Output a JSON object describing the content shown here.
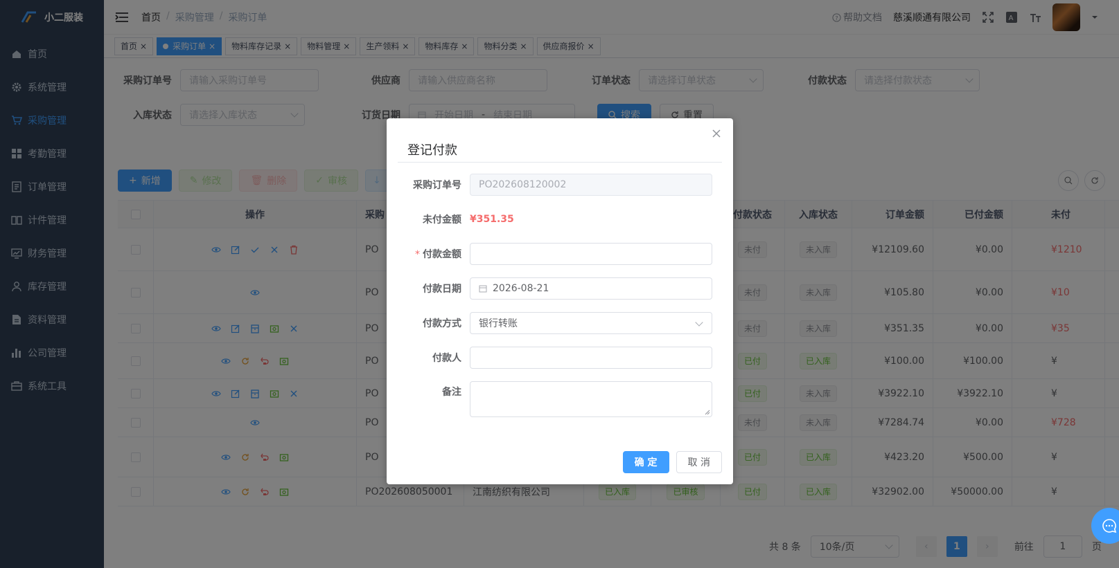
{
  "app": {
    "name": "小二服装"
  },
  "sidebar": {
    "items": [
      {
        "label": "首页",
        "icon": "home-icon"
      },
      {
        "label": "系统管理",
        "icon": "gear-icon"
      },
      {
        "label": "采购管理",
        "icon": "cart-icon",
        "active": true
      },
      {
        "label": "考勤管理",
        "icon": "grid-icon"
      },
      {
        "label": "订单管理",
        "icon": "list-icon"
      },
      {
        "label": "计件管理",
        "icon": "book-icon"
      },
      {
        "label": "财务管理",
        "icon": "chart-icon"
      },
      {
        "label": "库存管理",
        "icon": "user-icon"
      },
      {
        "label": "资料管理",
        "icon": "document-icon"
      },
      {
        "label": "公司管理",
        "icon": "bar-chart-icon"
      },
      {
        "label": "系统工具",
        "icon": "toolbox-icon"
      }
    ]
  },
  "header": {
    "breadcrumb": [
      "首页",
      "采购管理",
      "采购订单"
    ],
    "help": "帮助文档",
    "company": "慈溪顺通有限公司"
  },
  "tags": [
    {
      "label": "首页",
      "active": false
    },
    {
      "label": "采购订单",
      "active": true
    },
    {
      "label": "物料库存记录",
      "active": false
    },
    {
      "label": "物料管理",
      "active": false
    },
    {
      "label": "生产领料",
      "active": false
    },
    {
      "label": "物料库存",
      "active": false
    },
    {
      "label": "物料分类",
      "active": false
    },
    {
      "label": "供应商报价",
      "active": false
    }
  ],
  "search": {
    "order_no_label": "采购订单号",
    "order_no_ph": "请输入采购订单号",
    "supplier_label": "供应商",
    "supplier_ph": "请输入供应商名称",
    "order_status_label": "订单状态",
    "order_status_ph": "请选择订单状态",
    "pay_status_label": "付款状态",
    "pay_status_ph": "请选择付款状态",
    "stock_status_label": "入库状态",
    "stock_status_ph": "请选择入库状态",
    "date_label": "订货日期",
    "start_ph": "开始日期",
    "end_ph": "结束日期",
    "date_sep": "-",
    "search_btn": "搜索",
    "reset_btn": "重置"
  },
  "toolbar": {
    "add": "新增",
    "edit": "修改",
    "delete": "删除",
    "audit": "审核"
  },
  "table": {
    "headers": {
      "ops": "操作",
      "order_no": "采购",
      "pay_status": "付款状态",
      "stock_status": "入库状态",
      "amount": "订单金额",
      "paid": "已付金额",
      "unpaid": "未付"
    },
    "rows": [
      {
        "order_no": "PO",
        "supplier": "",
        "stock": "",
        "audit": "",
        "pay": "未付",
        "instock": "未入库",
        "amount": "¥12109.60",
        "paid": "¥0.00",
        "unpaid": "¥1210",
        "unpaid_red": true,
        "ops": [
          "eye-icon",
          "edit-icon",
          "check-icon",
          "close-icon",
          "delete-icon"
        ]
      },
      {
        "order_no": "PO",
        "supplier": "",
        "stock": "",
        "audit": "",
        "pay": "未付",
        "instock": "未入库",
        "amount": "¥105.80",
        "paid": "¥0.00",
        "unpaid": "¥10",
        "unpaid_red": true,
        "ops": [
          "eye-icon"
        ]
      },
      {
        "order_no": "PO",
        "supplier": "",
        "stock": "",
        "audit": "",
        "pay": "未付",
        "instock": "未入库",
        "amount": "¥351.35",
        "paid": "¥0.00",
        "unpaid": "¥35",
        "unpaid_red": true,
        "ops": [
          "eye-icon",
          "edit-icon",
          "box-icon",
          "money-icon",
          "close-icon"
        ]
      },
      {
        "order_no": "PO",
        "supplier": "",
        "stock": "",
        "audit": "",
        "pay": "已付",
        "instock": "已入库",
        "amount": "¥100.00",
        "paid": "¥100.00",
        "unpaid": "¥",
        "unpaid_red": false,
        "ops": [
          "eye-icon",
          "refresh-icon",
          "return-icon",
          "money-icon"
        ]
      },
      {
        "order_no": "PO",
        "supplier": "",
        "stock": "",
        "audit": "",
        "pay": "已付",
        "instock": "未入库",
        "amount": "¥3922.10",
        "paid": "¥3922.10",
        "unpaid": "¥",
        "unpaid_red": false,
        "ops": [
          "eye-icon",
          "edit-icon",
          "box-icon",
          "money-icon",
          "close-icon"
        ]
      },
      {
        "order_no": "PO",
        "supplier": "",
        "stock": "",
        "audit": "",
        "pay": "未付",
        "instock": "未入库",
        "amount": "¥7284.74",
        "paid": "¥0.00",
        "unpaid": "¥728",
        "unpaid_red": true,
        "ops": [
          "eye-icon"
        ]
      },
      {
        "order_no": "PO",
        "supplier": "",
        "stock": "",
        "audit": "",
        "pay": "已付",
        "instock": "已入库",
        "amount": "¥423.20",
        "paid": "¥500.00",
        "unpaid": "¥",
        "unpaid_red": false,
        "ops": [
          "eye-icon",
          "refresh-icon",
          "return-icon",
          "money-icon"
        ]
      },
      {
        "order_no": "PO202608050001",
        "supplier": "江南纺织有限公司",
        "stock": "已入库",
        "audit": "已审核",
        "pay": "已付",
        "instock": "已入库",
        "amount": "¥32902.00",
        "paid": "¥50000.00",
        "unpaid": "¥",
        "unpaid_red": false,
        "ops": [
          "eye-icon",
          "refresh-icon",
          "return-icon",
          "money-icon"
        ]
      }
    ]
  },
  "pager": {
    "total": "共 8 条",
    "size": "10条/页",
    "page": "1",
    "goto": "前往",
    "goto_val": "1",
    "page_unit": "页"
  },
  "dialog": {
    "title": "登记付款",
    "order_no_label": "采购订单号",
    "order_no": "PO202608120002",
    "unpaid_label": "未付金额",
    "unpaid": "¥351.35",
    "amount_label": "付款金额",
    "required_mark": "*",
    "date_label": "付款日期",
    "date": "2026-08-21",
    "method_label": "付款方式",
    "method": "银行转账",
    "payer_label": "付款人",
    "remark_label": "备注",
    "confirm": "确 定",
    "cancel": "取 消"
  },
  "colors": {
    "primary": "#409eff",
    "sidebar": "#304156",
    "danger": "#f56c6c",
    "success": "#67c23a"
  }
}
